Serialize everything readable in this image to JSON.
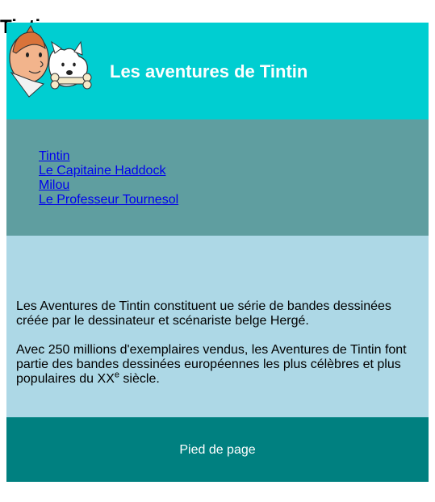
{
  "colors": {
    "header_bg": "#00CED1",
    "nav_bg": "#5F9EA0",
    "main_bg": "#ADD8E6",
    "footer_bg": "#008080",
    "link": "#0000EE",
    "text": "#000000"
  },
  "header": {
    "logo_icon": "tintin-milou-logo",
    "title": "Les aventures de Tintin"
  },
  "nav": {
    "links": [
      {
        "label": "Tintin"
      },
      {
        "label": "Le Capitaine Haddock"
      },
      {
        "label": "Milou"
      },
      {
        "label": "Le Professeur Tournesol"
      }
    ]
  },
  "main": {
    "heading": "Tintin",
    "paragraph1": "Les Aventures de Tintin constituent ue série de bandes dessinées créée par le dessinateur et scénariste belge Hergé.",
    "paragraph2_start": "Avec 250 millions d'exemplaires vendus, les Aventures de Tintin font partie des bandes dessinées européennes les plus célèbres et plus populaires du XX",
    "paragraph2_sup": "e",
    "paragraph2_end": " siècle."
  },
  "footer": {
    "text": "Pied de page"
  }
}
